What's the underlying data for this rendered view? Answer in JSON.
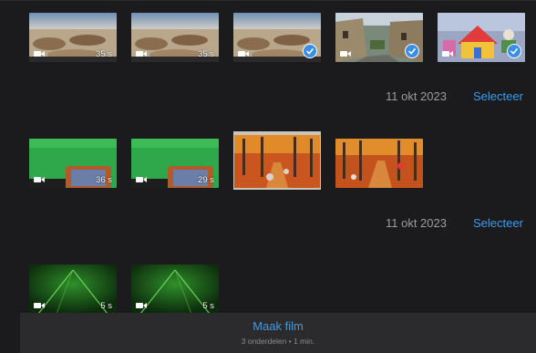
{
  "groups": [
    {
      "date": "",
      "items": [
        {
          "name": "beach-rocks-1",
          "duration": "35 s",
          "selected": false,
          "type": "video"
        },
        {
          "name": "beach-rocks-2",
          "duration": "35 s",
          "selected": false,
          "type": "video"
        },
        {
          "name": "beach-rocks-3",
          "duration": "",
          "selected": true,
          "type": "video"
        },
        {
          "name": "village-street",
          "duration": "",
          "selected": true,
          "type": "video"
        },
        {
          "name": "toy-house",
          "duration": "",
          "selected": true,
          "type": "video"
        }
      ]
    },
    {
      "date": "11 okt 2023",
      "select_label": "Selecteer",
      "items": [
        {
          "name": "green-screen-1",
          "duration": "36 s",
          "type": "video"
        },
        {
          "name": "green-screen-2",
          "duration": "29 s",
          "type": "video"
        },
        {
          "name": "autumn-forest-1",
          "duration": "",
          "type": "photo"
        },
        {
          "name": "autumn-forest-2",
          "duration": "",
          "type": "photo"
        }
      ]
    },
    {
      "date": "11 okt 2023",
      "select_label": "Selecteer",
      "items": [
        {
          "name": "green-laser-1",
          "duration": "5 s",
          "type": "video"
        },
        {
          "name": "green-laser-2",
          "duration": "5 s",
          "type": "video"
        }
      ]
    }
  ],
  "bottom_bar": {
    "title": "Maak film",
    "subtitle": "3 onderdelen • 1 min."
  },
  "colors": {
    "accent": "#3d9be9",
    "background": "#1b1b1d",
    "selection_badge": "#3a8ee6"
  },
  "icons": {
    "video": "video-camera-icon",
    "selected": "checkmark-circle-icon"
  }
}
